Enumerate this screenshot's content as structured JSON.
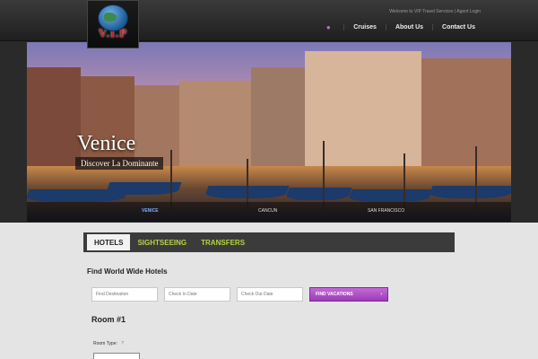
{
  "header": {
    "logo_text": "V.I.P",
    "welcome": "Welcome to VIP Travel Services",
    "agent_login": "Agent Login",
    "nav": [
      {
        "label": "Cruises"
      },
      {
        "label": "About Us"
      },
      {
        "label": "Contact Us"
      }
    ]
  },
  "hero": {
    "title": "Venice",
    "subtitle": "Discover La Dominante",
    "tabs": [
      "VENICE",
      "CANCUN",
      "SAN FRANCISCO"
    ],
    "active_tab": "VENICE"
  },
  "booking": {
    "tabs": [
      "HOTELS",
      "SIGHTSEEING",
      "TRANSFERS"
    ],
    "active_tab": "HOTELS",
    "heading": "Find World Wide Hotels",
    "destination_placeholder": "Find Destination",
    "checkin_placeholder": "Check In Date",
    "checkout_placeholder": "Check Out Date",
    "button_label": "FIND VACATIONS",
    "button_arrow": "›",
    "room_title": "Room #1",
    "room_type_label": "Room Type:",
    "room_type_info": "?"
  },
  "colors": {
    "accent_green": "#b7d442",
    "accent_purple": "#9c3bb8",
    "logo_red": "#c11f24"
  }
}
